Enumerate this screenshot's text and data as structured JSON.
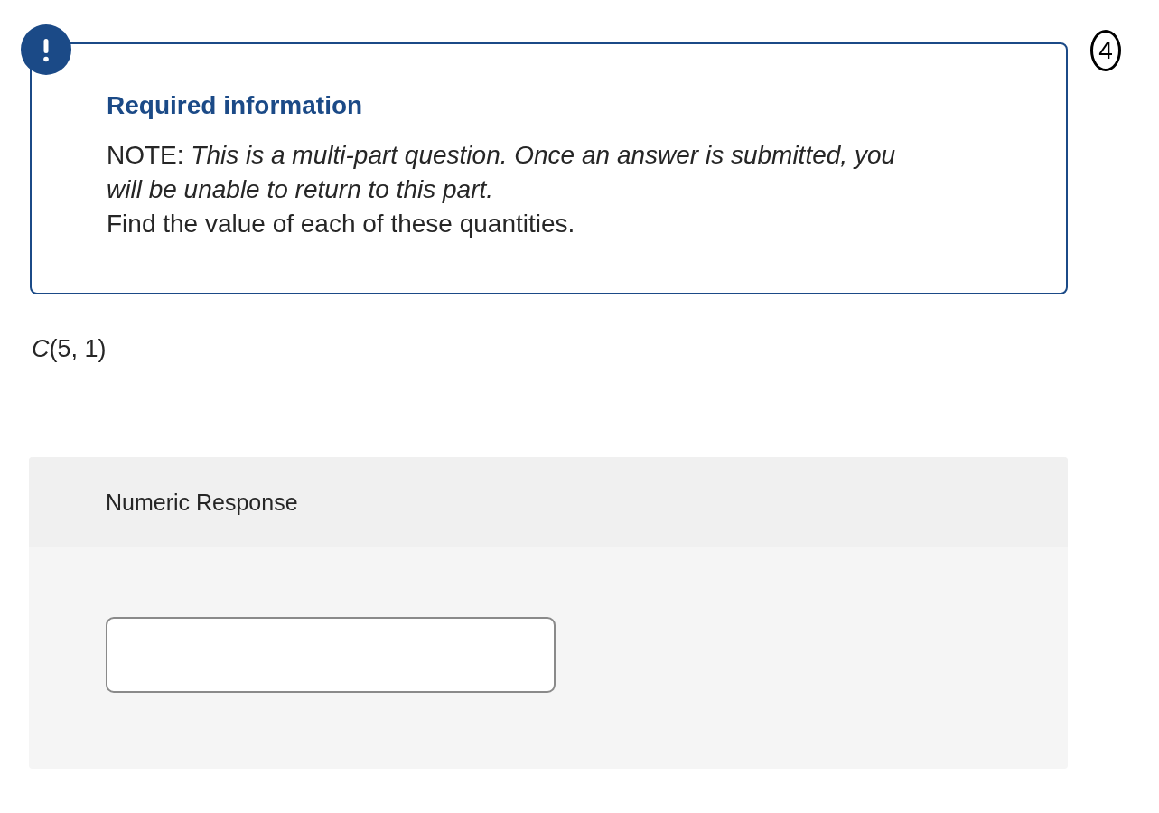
{
  "alert": {
    "title": "Required information",
    "note": "NOTE: *This is a multi-part question. Once an answer is submitted, you will be unable to return to this part.*",
    "instruction": "Find the value of each of these quantities."
  },
  "annotation": "4",
  "question": {
    "expression": "*C*(5, 1)"
  },
  "response": {
    "label": "Numeric Response"
  }
}
